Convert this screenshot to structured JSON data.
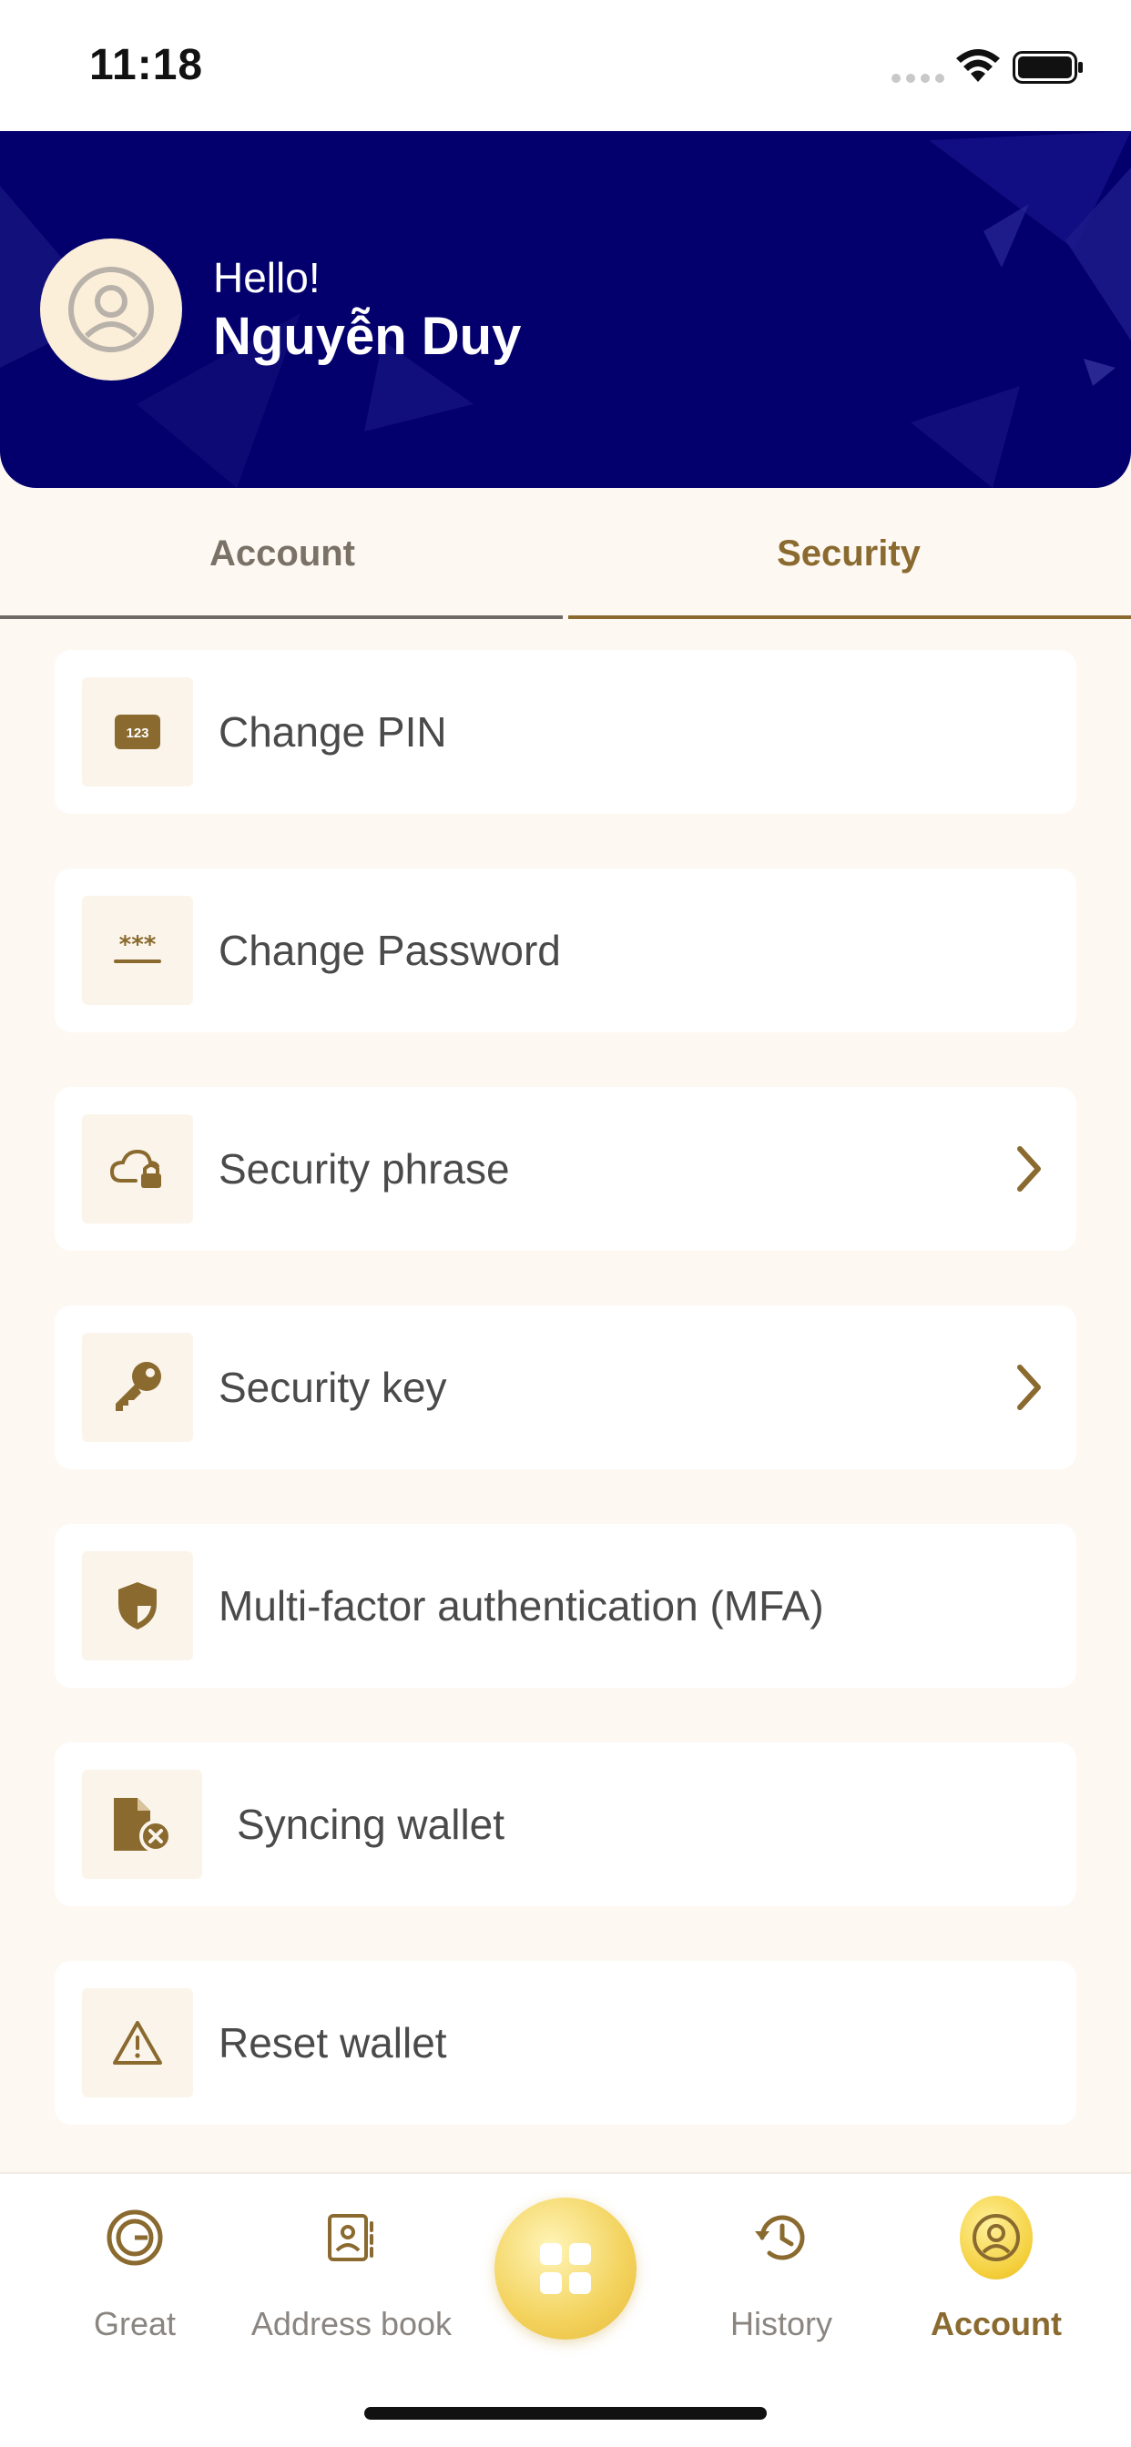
{
  "status_bar": {
    "time": "11:18"
  },
  "header": {
    "greeting": "Hello!",
    "user_name": "Nguyễn Duy"
  },
  "tabs": [
    {
      "label": "Account",
      "active": false
    },
    {
      "label": "Security",
      "active": true
    }
  ],
  "security_menu": [
    {
      "label": "Change PIN",
      "icon": "pin-123-icon",
      "has_chevron": false
    },
    {
      "label": "Change Password",
      "icon": "password-asterisks-icon",
      "has_chevron": false
    },
    {
      "label": "Security phrase",
      "icon": "cloud-lock-icon",
      "has_chevron": true
    },
    {
      "label": "Security key",
      "icon": "key-icon",
      "has_chevron": true
    },
    {
      "label": "Multi-factor authentication (MFA)",
      "icon": "shield-icon",
      "has_chevron": false
    },
    {
      "label": "Syncing wallet",
      "icon": "file-remove-icon",
      "has_chevron": false
    },
    {
      "label": "Reset wallet",
      "icon": "warning-triangle-icon",
      "has_chevron": false
    }
  ],
  "bottom_nav": [
    {
      "label": "Great",
      "icon": "great-logo-icon",
      "active": false
    },
    {
      "label": "Address book",
      "icon": "address-book-icon",
      "active": false
    },
    {
      "label": "",
      "icon": "apps-grid-icon",
      "active": false
    },
    {
      "label": "History",
      "icon": "history-icon",
      "active": false
    },
    {
      "label": "Account",
      "icon": "account-icon",
      "active": true
    }
  ],
  "colors": {
    "header_bg": "#03006e",
    "accent": "#8a6a2f",
    "page_bg": "#fdf8f2",
    "gold": "#f4cf3a"
  }
}
